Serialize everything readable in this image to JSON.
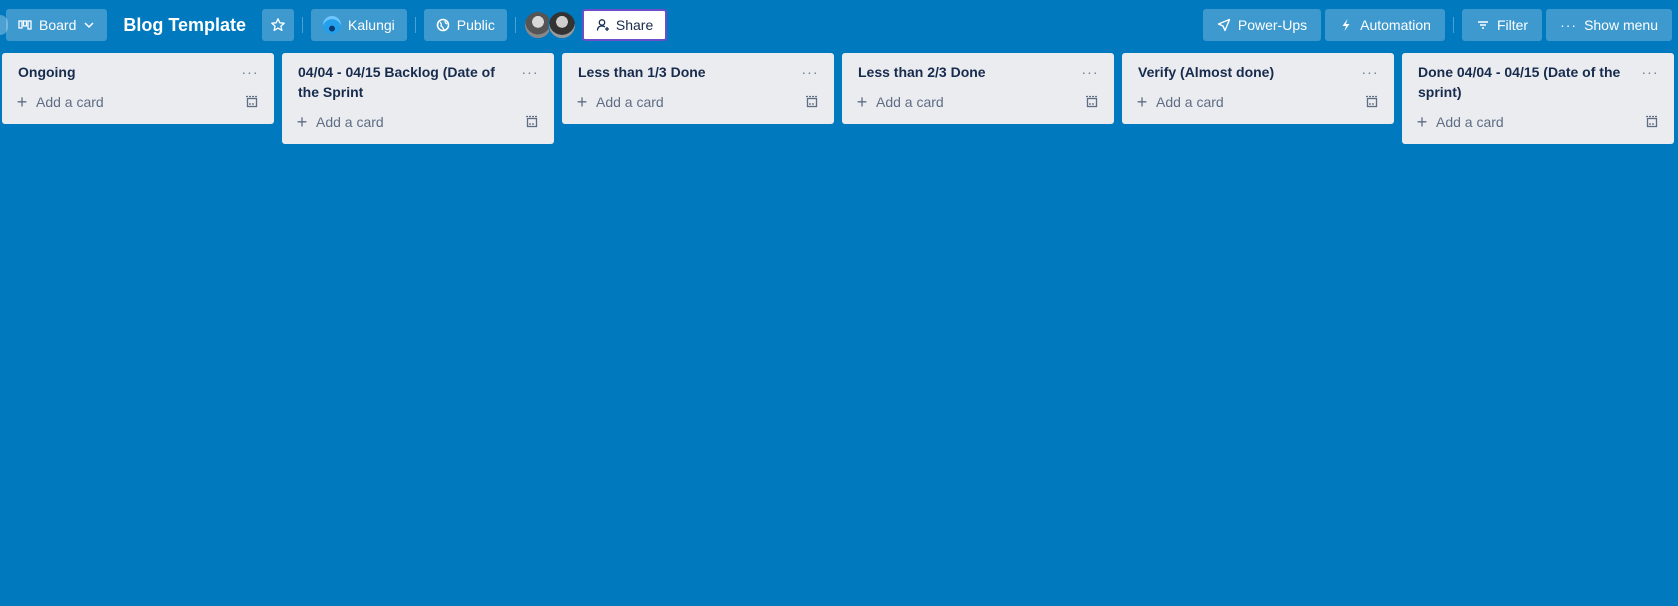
{
  "header": {
    "view_switcher_label": "Board",
    "board_title": "Blog Template",
    "workspace_label": "Kalungi",
    "visibility_label": "Public",
    "share_label": "Share",
    "members": [
      "member-1",
      "member-2"
    ],
    "power_ups_label": "Power-Ups",
    "automation_label": "Automation",
    "filter_label": "Filter",
    "show_menu_label": "Show menu"
  },
  "lists": [
    {
      "title": "Ongoing",
      "add_card_label": "Add a card"
    },
    {
      "title": "04/04 - 04/15 Backlog (Date of the Sprint",
      "add_card_label": "Add a card"
    },
    {
      "title": "Less than 1/3 Done",
      "add_card_label": "Add a card"
    },
    {
      "title": "Less than 2/3 Done",
      "add_card_label": "Add a card"
    },
    {
      "title": "Verify (Almost done)",
      "add_card_label": "Add a card"
    },
    {
      "title": "Done 04/04 - 04/15 (Date of the sprint)",
      "add_card_label": "Add a card"
    }
  ],
  "list_menu_glyph": "···",
  "colors": {
    "board_background": "#0079bf",
    "list_background": "#ebecf0",
    "share_border": "#6a4fc9"
  }
}
